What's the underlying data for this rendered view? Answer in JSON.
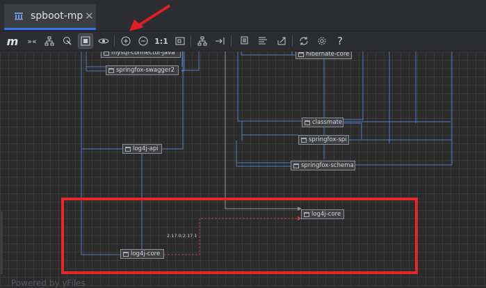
{
  "tab": {
    "title": "spboot-mp",
    "close_glyph": "✕",
    "icon": "module-diagram-icon"
  },
  "toolbar": {
    "logo": "m",
    "collapse_glyph": "»«",
    "zoom_actual": "1:1",
    "help_glyph": "?",
    "icons": [
      "collapse-icon",
      "hierarchy-layout-icon",
      "select-icon",
      "fit-content-icon",
      "eye-icon",
      "zoom-in-icon",
      "zoom-out-icon",
      "actual-size-icon",
      "fit-page-icon",
      "layout-icon",
      "route-edges-icon",
      "copy-icon",
      "show-list-icon",
      "export-icon",
      "refresh-icon",
      "settings-icon",
      "help-icon"
    ]
  },
  "nodes": {
    "mysql": "mysql-connector-java",
    "swagger2": "springfox-swagger2",
    "log4j_api": "log4j-api",
    "hibernate": "hibernate-core",
    "classmate": "classmate",
    "spi": "springfox-spi",
    "schema": "springfox-schema",
    "log4j_core_right": "log4j-core",
    "log4j_core_left": "log4j-core"
  },
  "edge_label": "2.17.0;2.17.1",
  "footer": "Powered by yFiles",
  "colors": {
    "edge": "#4f7bbf",
    "conflict_edge": "#b54747",
    "highlight_box": "#e5272b",
    "arrow": "#e01e24",
    "tab_accent": "#3574f0"
  }
}
